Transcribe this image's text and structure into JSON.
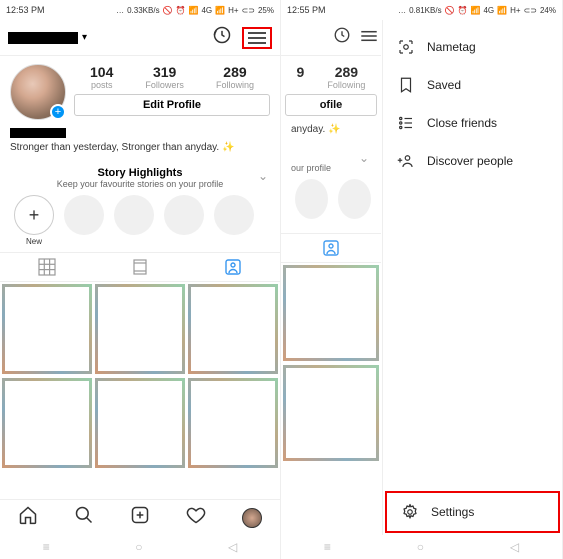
{
  "screen1": {
    "status": {
      "time": "12:53 PM",
      "speed": "0.33KB/s",
      "net": "4G",
      "sig": "H+",
      "batt": "25%"
    },
    "stats": {
      "posts": {
        "n": "104",
        "l": "posts"
      },
      "followers": {
        "n": "319",
        "l": "Followers"
      },
      "following": {
        "n": "289",
        "l": "Following"
      }
    },
    "edit": "Edit Profile",
    "bio": "Stronger than yesterday, Stronger than anyday. ✨",
    "highlights": {
      "title": "Story Highlights",
      "sub": "Keep your favourite stories on your profile",
      "new": "New"
    }
  },
  "screen2": {
    "status": {
      "time": "12:55 PM",
      "speed": "0.81KB/s",
      "net": "4G",
      "sig": "H+",
      "batt": "24%"
    },
    "stats": {
      "following9": "9",
      "following": {
        "n": "289",
        "l": "Following"
      }
    },
    "edit": "ofile",
    "bio": "anyday. ✨",
    "highlights_sub": "our profile",
    "menu": {
      "nametag": "Nametag",
      "saved": "Saved",
      "close": "Close friends",
      "discover": "Discover people",
      "settings": "Settings"
    }
  }
}
